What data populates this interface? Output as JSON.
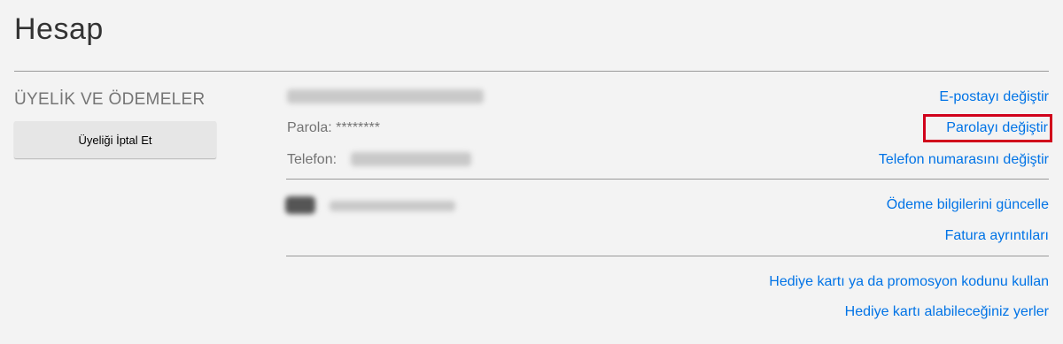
{
  "page": {
    "title": "Hesap"
  },
  "membership": {
    "section_title": "ÜYELİK VE ÖDEMELER",
    "cancel_button_label": "Üyeliği İptal Et"
  },
  "account": {
    "password_label": "Parola: ********",
    "phone_label": "Telefon:",
    "change_email_link": "E-postayı değiştir",
    "change_password_link": "Parolayı değiştir",
    "change_phone_link": "Telefon numarasını değiştir"
  },
  "payment": {
    "update_payment_link": "Ödeme bilgilerini güncelle",
    "billing_details_link": "Fatura ayrıntıları"
  },
  "gift": {
    "redeem_link": "Hediye kartı ya da promosyon kodunu kullan",
    "where_to_buy_link": "Hediye kartı alabileceğiniz yerler"
  },
  "colors": {
    "link": "#0073e6",
    "highlight": "#d0021b",
    "background": "#f3f3f3"
  }
}
